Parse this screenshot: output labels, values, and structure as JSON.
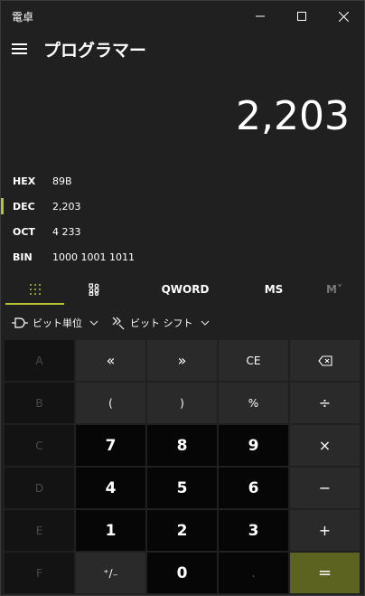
{
  "window": {
    "title": "電卓"
  },
  "header": {
    "mode_title": "プログラマー"
  },
  "display": {
    "value": "2,203"
  },
  "radix": [
    {
      "label": "HEX",
      "value": "89B",
      "active": false
    },
    {
      "label": "DEC",
      "value": "2,203",
      "active": true
    },
    {
      "label": "OCT",
      "value": "4 233",
      "active": false
    },
    {
      "label": "BIN",
      "value": "1000 1001 1011",
      "active": false
    }
  ],
  "tabs": {
    "word_size": "QWORD",
    "memory_store": "MS",
    "memory_recall": "M˅"
  },
  "bit_toolbar": {
    "bitwise_label": "ビット単位",
    "bitshift_label": "ビット シフト"
  },
  "keys": {
    "a": "A",
    "lshift": "«",
    "rshift": "»",
    "ce": "CE",
    "b": "B",
    "lparen": "(",
    "rparen": ")",
    "percent": "%",
    "divide": "÷",
    "c": "C",
    "n7": "7",
    "n8": "8",
    "n9": "9",
    "multiply": "×",
    "d": "D",
    "n4": "4",
    "n5": "5",
    "n6": "6",
    "minus": "−",
    "e": "E",
    "n1": "1",
    "n2": "2",
    "n3": "3",
    "plus": "+",
    "f": "F",
    "negate": "⁺∕₋",
    "n0": "0",
    "decimal": ".",
    "equals": "="
  },
  "colors": {
    "accent": "#b5c334",
    "equals_bg": "#5c6320"
  }
}
